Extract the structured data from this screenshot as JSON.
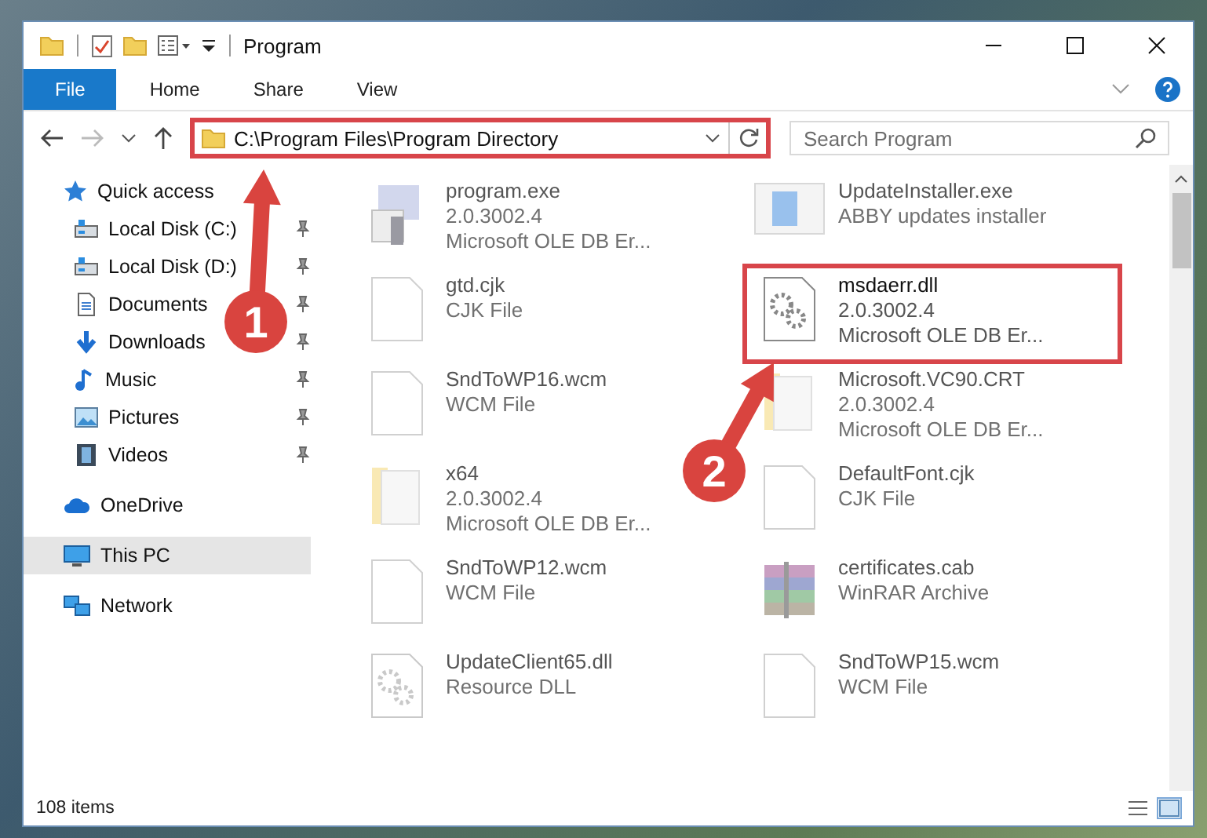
{
  "window": {
    "title": "Program"
  },
  "ribbon": {
    "tabs": [
      {
        "label": "File",
        "kind": "file"
      },
      {
        "label": "Home",
        "kind": "tab"
      },
      {
        "label": "Share",
        "kind": "tab"
      },
      {
        "label": "View",
        "kind": "tab"
      }
    ]
  },
  "address": {
    "path": "C:\\Program Files\\Program Directory",
    "highlighted": true
  },
  "search": {
    "placeholder": "Search Program"
  },
  "navigation": [
    {
      "label": "Quick access",
      "selected": false,
      "children": [
        {
          "label": "Local Disk (C:)",
          "selected": false,
          "pinned": true
        },
        {
          "label": "Local Disk (D:)",
          "selected": false,
          "pinned": true
        },
        {
          "label": "Documents",
          "selected": false,
          "pinned": true
        },
        {
          "label": "Downloads",
          "selected": false,
          "pinned": true
        },
        {
          "label": "Music",
          "selected": false,
          "pinned": true
        },
        {
          "label": "Pictures",
          "selected": false,
          "pinned": true
        },
        {
          "label": "Videos",
          "selected": false,
          "pinned": true
        }
      ]
    },
    {
      "label": "OneDrive",
      "selected": false
    },
    {
      "label": "This PC",
      "selected": true
    },
    {
      "label": "Network",
      "selected": false
    }
  ],
  "files": [
    {
      "name": "program.exe",
      "details": [
        "2.0.3002.4",
        "Microsoft OLE DB Er..."
      ],
      "highlighted": false
    },
    {
      "name": "UpdateInstaller.exe",
      "details": [
        "ABBY updates installer"
      ],
      "highlighted": false
    },
    {
      "name": "gtd.cjk",
      "details": [
        "CJK File"
      ],
      "highlighted": false
    },
    {
      "name": "msdaerr.dll",
      "details": [
        "2.0.3002.4",
        "Microsoft OLE DB Er..."
      ],
      "highlighted": true
    },
    {
      "name": "SndToWP16.wcm",
      "details": [
        "WCM File"
      ],
      "highlighted": false
    },
    {
      "name": "Microsoft.VC90.CRT",
      "details": [
        "2.0.3002.4",
        "Microsoft OLE DB Er..."
      ],
      "highlighted": false
    },
    {
      "name": "x64",
      "details": [
        "2.0.3002.4",
        "Microsoft OLE DB Er..."
      ],
      "highlighted": false
    },
    {
      "name": "DefaultFont.cjk",
      "details": [
        "CJK File"
      ],
      "highlighted": false
    },
    {
      "name": "SndToWP12.wcm",
      "details": [
        "WCM File"
      ],
      "highlighted": false
    },
    {
      "name": "certificates.cab",
      "details": [
        "WinRAR Archive"
      ],
      "highlighted": false
    },
    {
      "name": "UpdateClient65.dll",
      "details": [
        "Resource DLL"
      ],
      "highlighted": false
    },
    {
      "name": "SndToWP15.wcm",
      "details": [
        "WCM File"
      ],
      "highlighted": false
    }
  ],
  "status_bar": {
    "count": "108 items"
  },
  "annotations": [
    {
      "label": "1"
    },
    {
      "label": "2"
    }
  ]
}
